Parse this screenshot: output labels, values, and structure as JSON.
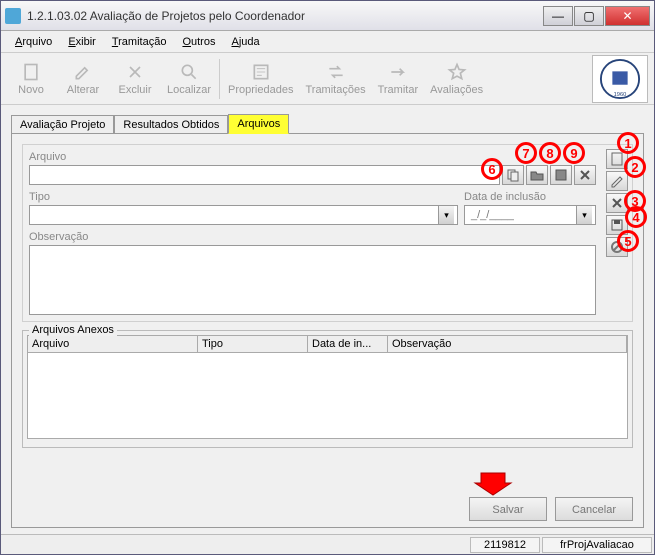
{
  "window": {
    "title": "1.2.1.03.02 Avaliação de Projetos pelo Coordenador"
  },
  "menubar": {
    "items": [
      "Arquivo",
      "Exibir",
      "Tramitação",
      "Outros",
      "Ajuda"
    ]
  },
  "toolbar": {
    "novo": "Novo",
    "alterar": "Alterar",
    "excluir": "Excluir",
    "localizar": "Localizar",
    "propriedades": "Propriedades",
    "tramitacoes": "Tramitações",
    "tramitar": "Tramitar",
    "avaliacoes": "Avaliações"
  },
  "tabs": {
    "avaliacao_projeto": "Avaliação Projeto",
    "resultados_obtidos": "Resultados Obtidos",
    "arquivos": "Arquivos"
  },
  "upper": {
    "arquivo_label": "Arquivo",
    "arquivo_value": "",
    "tipo_label": "Tipo",
    "tipo_value": "",
    "data_inclusao_label": "Data de inclusão",
    "data_inclusao_value": "_/_/____",
    "observacao_label": "Observação",
    "observacao_value": ""
  },
  "annotations": {
    "m1": "1",
    "m2": "2",
    "m3": "3",
    "m4": "4",
    "m5": "5",
    "m6": "6",
    "m7": "7",
    "m8": "8",
    "m9": "9"
  },
  "group": {
    "label": "Arquivos Anexos",
    "columns": [
      "Arquivo",
      "Tipo",
      "Data de in...",
      "Observação"
    ]
  },
  "buttons": {
    "salvar": "Salvar",
    "cancelar": "Cancelar"
  },
  "statusbar": {
    "code": "2119812",
    "form": "frProjAvaliacao"
  }
}
